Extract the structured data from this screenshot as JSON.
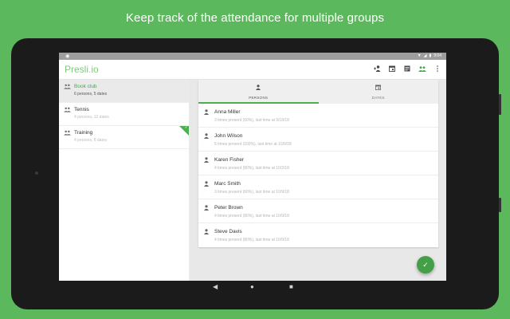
{
  "headline": "Keep track of the attendance for multiple groups",
  "status_bar": {
    "time": "9:04"
  },
  "app": {
    "brand_left": "Presli",
    "brand_sep": ".",
    "brand_right": "io"
  },
  "toolbar": {
    "icons": [
      "add-person-icon",
      "calendar-icon",
      "document-icon",
      "groups-icon",
      "more-vert-icon"
    ]
  },
  "groups": [
    {
      "name": "Book club",
      "subtitle": "6 persons, 5 dates",
      "selected": true
    },
    {
      "name": "Tennis",
      "subtitle": "4 persons, 12 dates",
      "selected": false
    },
    {
      "name": "Training",
      "subtitle": "4 persons, 8 dates",
      "selected": false,
      "marked": true
    }
  ],
  "tabs": [
    {
      "label": "PERSONS",
      "icon": "person-icon",
      "active": true
    },
    {
      "label": "DATES",
      "icon": "calendar-icon",
      "active": false
    }
  ],
  "persons": [
    {
      "name": "Anna Miller",
      "stats": "3 times present (60%), last time at 9/18/18"
    },
    {
      "name": "John Wilson",
      "stats": "5 times present (100%), last time at 10/9/18"
    },
    {
      "name": "Karen Fisher",
      "stats": "4 times present (80%), last time at 10/2/18"
    },
    {
      "name": "Marc Smith",
      "stats": "3 times present (60%), last time at 10/9/18"
    },
    {
      "name": "Peter Brown",
      "stats": "4 times present (80%), last time at 10/9/18"
    },
    {
      "name": "Steve Davis",
      "stats": "4 times present (80%), last time at 10/9/18"
    }
  ],
  "colors": {
    "brand_green": "#7ccc7c",
    "accent": "#4caf50",
    "background": "#5cb85c"
  }
}
